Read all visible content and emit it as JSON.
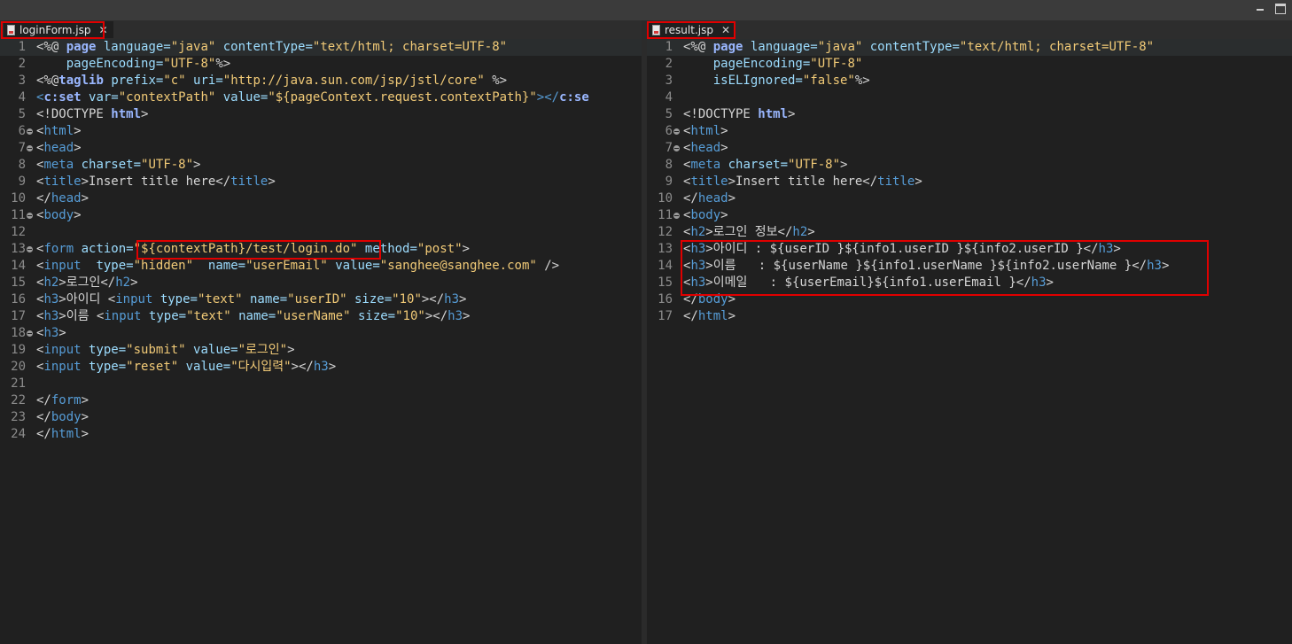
{
  "window": {
    "minimize_icon": "minimize-icon",
    "maximize_icon": "maximize-icon"
  },
  "left": {
    "tab": {
      "label": "loginForm.jsp",
      "close": "✕"
    },
    "lines": [
      {
        "n": "1",
        "fold": false,
        "seg": [
          [
            "<%@ ",
            "b"
          ],
          [
            "page ",
            "k"
          ],
          [
            "language=",
            "a"
          ],
          [
            "\"java\" ",
            "s"
          ],
          [
            "contentType=",
            "a"
          ],
          [
            "\"text/html; charset=UTF-8\"",
            "s"
          ]
        ]
      },
      {
        "n": "2",
        "fold": false,
        "seg": [
          [
            "    pageEncoding=",
            "a"
          ],
          [
            "\"UTF-8\"",
            "s"
          ],
          [
            "%>",
            "b"
          ]
        ]
      },
      {
        "n": "3",
        "fold": false,
        "seg": [
          [
            "<%@",
            "b"
          ],
          [
            "taglib ",
            "k"
          ],
          [
            "prefix=",
            "a"
          ],
          [
            "\"c\" ",
            "s"
          ],
          [
            "uri=",
            "a"
          ],
          [
            "\"http://java.sun.com/jsp/jstl/core\" ",
            "s"
          ],
          [
            "%>",
            "b"
          ]
        ]
      },
      {
        "n": "4",
        "fold": false,
        "seg": [
          [
            "<",
            "t"
          ],
          [
            "c:set ",
            "k"
          ],
          [
            "var=",
            "a"
          ],
          [
            "\"contextPath\" ",
            "s"
          ],
          [
            "value=",
            "a"
          ],
          [
            "\"${pageContext.request.contextPath}\"",
            "s"
          ],
          [
            "></",
            "t"
          ],
          [
            "c:se",
            "k"
          ]
        ]
      },
      {
        "n": "5",
        "fold": false,
        "seg": [
          [
            "<!DOCTYPE ",
            "b"
          ],
          [
            "html",
            "k"
          ],
          [
            ">",
            "b"
          ]
        ]
      },
      {
        "n": "6",
        "fold": true,
        "seg": [
          [
            "<",
            "b"
          ],
          [
            "html",
            "t"
          ],
          [
            ">",
            "b"
          ]
        ]
      },
      {
        "n": "7",
        "fold": true,
        "seg": [
          [
            "<",
            "b"
          ],
          [
            "head",
            "t"
          ],
          [
            ">",
            "b"
          ]
        ]
      },
      {
        "n": "8",
        "fold": false,
        "seg": [
          [
            "<",
            "b"
          ],
          [
            "meta ",
            "t"
          ],
          [
            "charset=",
            "a"
          ],
          [
            "\"UTF-8\"",
            "s"
          ],
          [
            ">",
            "b"
          ]
        ]
      },
      {
        "n": "9",
        "fold": false,
        "seg": [
          [
            "<",
            "b"
          ],
          [
            "title",
            "t"
          ],
          [
            ">Insert title here</",
            "b"
          ],
          [
            "title",
            "t"
          ],
          [
            ">",
            "b"
          ]
        ]
      },
      {
        "n": "10",
        "fold": false,
        "seg": [
          [
            "</",
            "b"
          ],
          [
            "head",
            "t"
          ],
          [
            ">",
            "b"
          ]
        ]
      },
      {
        "n": "11",
        "fold": true,
        "seg": [
          [
            "<",
            "b"
          ],
          [
            "body",
            "t"
          ],
          [
            ">",
            "b"
          ]
        ]
      },
      {
        "n": "12",
        "fold": false,
        "seg": []
      },
      {
        "n": "13",
        "fold": true,
        "seg": [
          [
            "<",
            "b"
          ],
          [
            "form ",
            "t"
          ],
          [
            "action=",
            "a"
          ],
          [
            "\"${contextPath}/test/login.do\" ",
            "s"
          ],
          [
            "method=",
            "a"
          ],
          [
            "\"post\"",
            "s"
          ],
          [
            ">",
            "b"
          ]
        ]
      },
      {
        "n": "14",
        "fold": false,
        "seg": [
          [
            "<",
            "b"
          ],
          [
            "input  ",
            "t"
          ],
          [
            "type=",
            "a"
          ],
          [
            "\"hidden\"  ",
            "s"
          ],
          [
            "name=",
            "a"
          ],
          [
            "\"userEmail\" ",
            "s"
          ],
          [
            "value=",
            "a"
          ],
          [
            "\"sanghee@sanghee.com\" ",
            "s"
          ],
          [
            "/>",
            "b"
          ]
        ]
      },
      {
        "n": "15",
        "fold": false,
        "seg": [
          [
            "<",
            "b"
          ],
          [
            "h2",
            "t"
          ],
          [
            ">로그인</",
            "b"
          ],
          [
            "h2",
            "t"
          ],
          [
            ">",
            "b"
          ]
        ]
      },
      {
        "n": "16",
        "fold": false,
        "seg": [
          [
            "<",
            "b"
          ],
          [
            "h3",
            "t"
          ],
          [
            ">아이디 <",
            "b"
          ],
          [
            "input ",
            "t"
          ],
          [
            "type=",
            "a"
          ],
          [
            "\"text\" ",
            "s"
          ],
          [
            "name=",
            "a"
          ],
          [
            "\"userID\" ",
            "s"
          ],
          [
            "size=",
            "a"
          ],
          [
            "\"10\"",
            "s"
          ],
          [
            "></",
            "b"
          ],
          [
            "h3",
            "t"
          ],
          [
            ">",
            "b"
          ]
        ]
      },
      {
        "n": "17",
        "fold": false,
        "seg": [
          [
            "<",
            "b"
          ],
          [
            "h3",
            "t"
          ],
          [
            ">이름 <",
            "b"
          ],
          [
            "input ",
            "t"
          ],
          [
            "type=",
            "a"
          ],
          [
            "\"text\" ",
            "s"
          ],
          [
            "name=",
            "a"
          ],
          [
            "\"userName\" ",
            "s"
          ],
          [
            "size=",
            "a"
          ],
          [
            "\"10\"",
            "s"
          ],
          [
            "></",
            "b"
          ],
          [
            "h3",
            "t"
          ],
          [
            ">",
            "b"
          ]
        ]
      },
      {
        "n": "18",
        "fold": true,
        "seg": [
          [
            "<",
            "b"
          ],
          [
            "h3",
            "t"
          ],
          [
            ">",
            "b"
          ]
        ]
      },
      {
        "n": "19",
        "fold": false,
        "seg": [
          [
            "<",
            "b"
          ],
          [
            "input ",
            "t"
          ],
          [
            "type=",
            "a"
          ],
          [
            "\"submit\" ",
            "s"
          ],
          [
            "value=",
            "a"
          ],
          [
            "\"로그인\"",
            "s"
          ],
          [
            ">",
            "b"
          ]
        ]
      },
      {
        "n": "20",
        "fold": false,
        "seg": [
          [
            "<",
            "b"
          ],
          [
            "input ",
            "t"
          ],
          [
            "type=",
            "a"
          ],
          [
            "\"reset\" ",
            "s"
          ],
          [
            "value=",
            "a"
          ],
          [
            "\"다시입력\"",
            "s"
          ],
          [
            "></",
            "b"
          ],
          [
            "h3",
            "t"
          ],
          [
            ">",
            "b"
          ]
        ]
      },
      {
        "n": "21",
        "fold": false,
        "seg": []
      },
      {
        "n": "22",
        "fold": false,
        "seg": [
          [
            "</",
            "b"
          ],
          [
            "form",
            "t"
          ],
          [
            ">",
            "b"
          ]
        ]
      },
      {
        "n": "23",
        "fold": false,
        "seg": [
          [
            "</",
            "b"
          ],
          [
            "body",
            "t"
          ],
          [
            ">",
            "b"
          ]
        ]
      },
      {
        "n": "24",
        "fold": false,
        "seg": [
          [
            "</",
            "b"
          ],
          [
            "html",
            "t"
          ],
          [
            ">",
            "b"
          ]
        ]
      }
    ]
  },
  "right": {
    "tab": {
      "label": "result.jsp",
      "close": "✕"
    },
    "lines": [
      {
        "n": "1",
        "fold": false,
        "seg": [
          [
            "<%@ ",
            "b"
          ],
          [
            "page ",
            "k"
          ],
          [
            "language=",
            "a"
          ],
          [
            "\"java\" ",
            "s"
          ],
          [
            "contentType=",
            "a"
          ],
          [
            "\"text/html; charset=UTF-8\"",
            "s"
          ]
        ]
      },
      {
        "n": "2",
        "fold": false,
        "seg": [
          [
            "    pageEncoding=",
            "a"
          ],
          [
            "\"UTF-8\"",
            "s"
          ]
        ]
      },
      {
        "n": "3",
        "fold": false,
        "seg": [
          [
            "    isELIgnored=",
            "a"
          ],
          [
            "\"false\"",
            "s"
          ],
          [
            "%>",
            "b"
          ]
        ]
      },
      {
        "n": "4",
        "fold": false,
        "seg": []
      },
      {
        "n": "5",
        "fold": false,
        "seg": [
          [
            "<!DOCTYPE ",
            "b"
          ],
          [
            "html",
            "k"
          ],
          [
            ">",
            "b"
          ]
        ]
      },
      {
        "n": "6",
        "fold": true,
        "seg": [
          [
            "<",
            "b"
          ],
          [
            "html",
            "t"
          ],
          [
            ">",
            "b"
          ]
        ]
      },
      {
        "n": "7",
        "fold": true,
        "seg": [
          [
            "<",
            "b"
          ],
          [
            "head",
            "t"
          ],
          [
            ">",
            "b"
          ]
        ]
      },
      {
        "n": "8",
        "fold": false,
        "seg": [
          [
            "<",
            "b"
          ],
          [
            "meta ",
            "t"
          ],
          [
            "charset=",
            "a"
          ],
          [
            "\"UTF-8\"",
            "s"
          ],
          [
            ">",
            "b"
          ]
        ]
      },
      {
        "n": "9",
        "fold": false,
        "seg": [
          [
            "<",
            "b"
          ],
          [
            "title",
            "t"
          ],
          [
            ">Insert title here</",
            "b"
          ],
          [
            "title",
            "t"
          ],
          [
            ">",
            "b"
          ]
        ]
      },
      {
        "n": "10",
        "fold": false,
        "seg": [
          [
            "</",
            "b"
          ],
          [
            "head",
            "t"
          ],
          [
            ">",
            "b"
          ]
        ]
      },
      {
        "n": "11",
        "fold": true,
        "seg": [
          [
            "<",
            "b"
          ],
          [
            "body",
            "t"
          ],
          [
            ">",
            "b"
          ]
        ]
      },
      {
        "n": "12",
        "fold": false,
        "seg": [
          [
            "<",
            "b"
          ],
          [
            "h2",
            "t"
          ],
          [
            ">로그인 정보</",
            "b"
          ],
          [
            "h2",
            "t"
          ],
          [
            ">",
            "b"
          ]
        ]
      },
      {
        "n": "13",
        "fold": false,
        "seg": [
          [
            "<",
            "b"
          ],
          [
            "h3",
            "t"
          ],
          [
            ">아이디 : ${userID }${info1.userID }${info2.userID }</",
            "b"
          ],
          [
            "h3",
            "t"
          ],
          [
            ">",
            "b"
          ]
        ]
      },
      {
        "n": "14",
        "fold": false,
        "seg": [
          [
            "<",
            "b"
          ],
          [
            "h3",
            "t"
          ],
          [
            ">이름   : ${userName }${info1.userName }${info2.userName }</",
            "b"
          ],
          [
            "h3",
            "t"
          ],
          [
            ">",
            "b"
          ]
        ]
      },
      {
        "n": "15",
        "fold": false,
        "seg": [
          [
            "<",
            "b"
          ],
          [
            "h3",
            "t"
          ],
          [
            ">이메일   : ${userEmail}${info1.userEmail }</",
            "b"
          ],
          [
            "h3",
            "t"
          ],
          [
            ">",
            "b"
          ]
        ]
      },
      {
        "n": "16",
        "fold": false,
        "seg": [
          [
            "</",
            "b"
          ],
          [
            "body",
            "t"
          ],
          [
            ">",
            "b"
          ]
        ]
      },
      {
        "n": "17",
        "fold": false,
        "seg": [
          [
            "</",
            "b"
          ],
          [
            "html",
            "t"
          ],
          [
            ">",
            "b"
          ]
        ]
      }
    ]
  }
}
